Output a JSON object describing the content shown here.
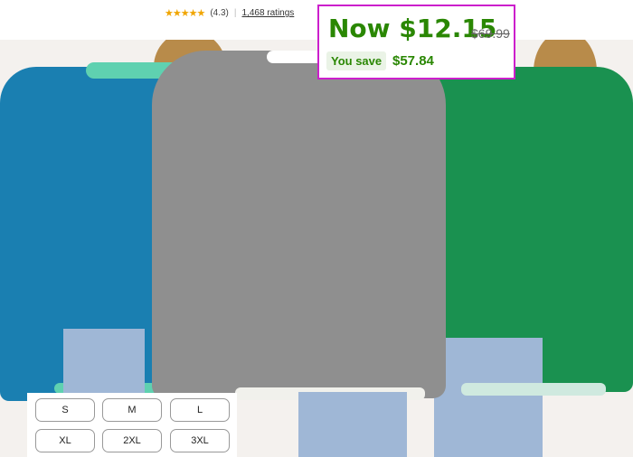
{
  "rating": {
    "stars_icon": "rating-stars-icon",
    "stars": "★★★★★",
    "score": "(4.3)",
    "separator": "|",
    "count_label": "1,468 ratings"
  },
  "price": {
    "now_label": "Now $12.15",
    "was_label": "$69.99",
    "save_label": "You save",
    "save_amount": "$57.84"
  },
  "sizes": [
    "S",
    "M",
    "L",
    "XL",
    "2XL",
    "3XL"
  ],
  "colors": {
    "accent_price": "#2a8703",
    "highlight_border": "#cc1fcc",
    "sweater_blue": "#1a7fb1",
    "sweater_gray": "#8f8f8f",
    "sweater_green": "#1a9150"
  }
}
